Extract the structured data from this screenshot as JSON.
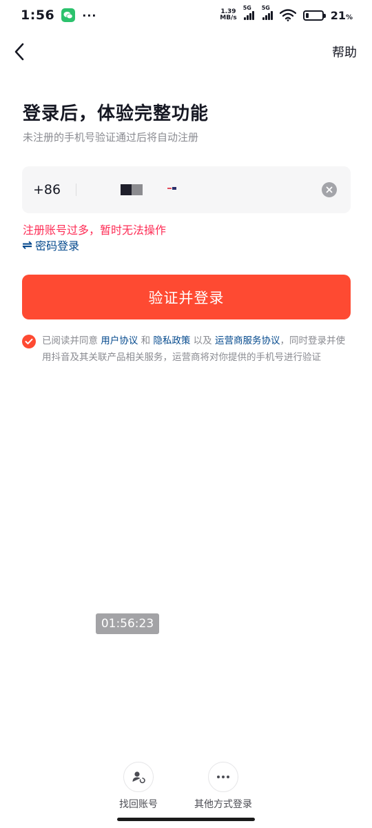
{
  "status_bar": {
    "time": "1:56",
    "more_indicator": "···",
    "net_speed_value": "1.39",
    "net_speed_unit": "MB/s",
    "sim1_label": "5G",
    "sim2_label": "5G",
    "battery_percent": "21",
    "battery_unit": "%",
    "battery_level": 0.21
  },
  "header": {
    "help_label": "帮助"
  },
  "main": {
    "title": "登录后，体验完整功能",
    "subtitle": "未注册的手机号验证通过后将自动注册",
    "country_code": "+86",
    "error_message": "注册账号过多，暂时无法操作",
    "password_login_label": "密码登录",
    "password_login_icon": "⇌",
    "submit_label": "验证并登录"
  },
  "agreement": {
    "prefix": "已阅读并同意 ",
    "user_agreement": "用户协议",
    "and": " 和 ",
    "privacy_policy": "隐私政策",
    "and2": " 以及 ",
    "carrier_agreement": "运营商服务协议",
    "suffix": "，同时登录并使用抖音及其关联产品相关服务，运营商将对你提供的手机号进行验证"
  },
  "timestamp": "01:56:23",
  "bottom": {
    "recover_label": "找回账号",
    "other_label": "其他方式登录"
  },
  "colors": {
    "accent": "#fe4a32",
    "error": "#fe2c55",
    "link": "#04498d"
  }
}
